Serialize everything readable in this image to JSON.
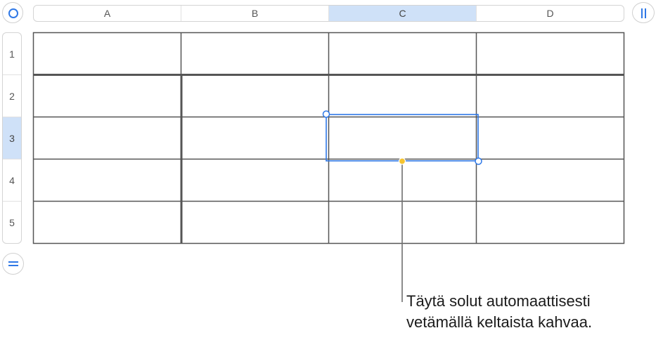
{
  "columns": [
    {
      "label": "A",
      "selected": false
    },
    {
      "label": "B",
      "selected": false
    },
    {
      "label": "C",
      "selected": true
    },
    {
      "label": "D",
      "selected": false
    }
  ],
  "rows": [
    {
      "label": "1",
      "selected": false
    },
    {
      "label": "2",
      "selected": false
    },
    {
      "label": "3",
      "selected": true
    },
    {
      "label": "4",
      "selected": false
    },
    {
      "label": "5",
      "selected": false
    }
  ],
  "selected_cell": {
    "column": "C",
    "row": "3"
  },
  "callout": {
    "line1": "Täytä solut automaattisesti",
    "line2": "vetämällä keltaista kahvaa."
  },
  "colors": {
    "accent": "#2f78e6",
    "header_selected": "#cfe1f8",
    "autofill_handle": "#f5c431",
    "grid_line": "#555555"
  }
}
